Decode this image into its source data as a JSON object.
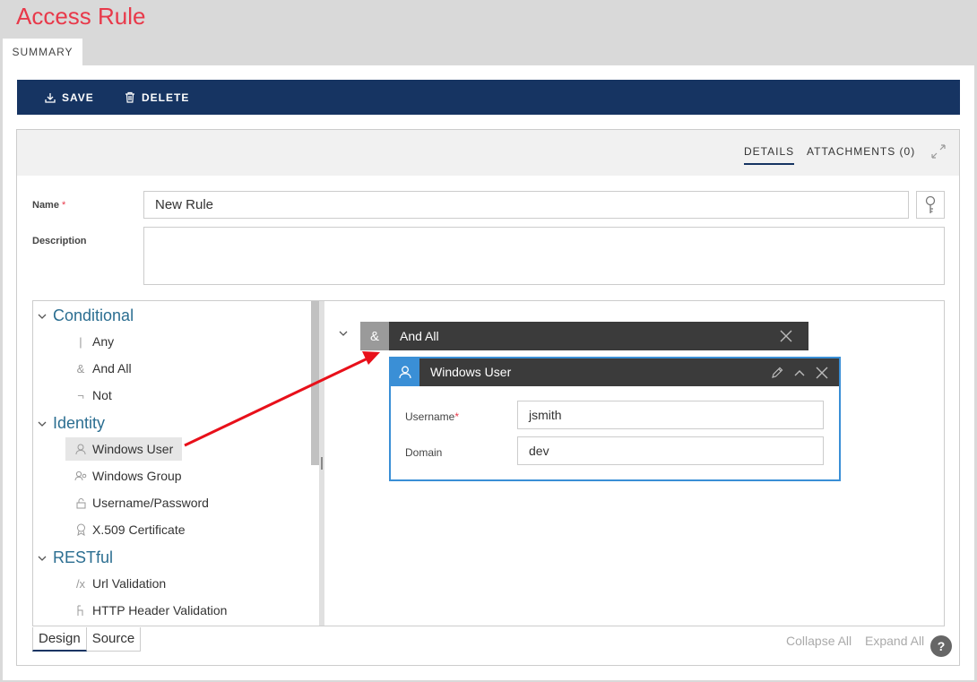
{
  "page": {
    "title": "Access Rule"
  },
  "tabs": [
    {
      "label": "SUMMARY"
    }
  ],
  "toolbar": {
    "save_label": "SAVE",
    "delete_label": "DELETE"
  },
  "panel": {
    "tabs": {
      "details": "DETAILS",
      "attachments": "ATTACHMENTS (0)"
    }
  },
  "form": {
    "name_label": "Name",
    "required_mark": "*",
    "name_value": "New Rule",
    "description_label": "Description",
    "description_value": ""
  },
  "palette": {
    "groups": [
      {
        "title": "Conditional",
        "items": [
          {
            "label": "Any",
            "icon": "|"
          },
          {
            "label": "And All",
            "icon": "&"
          },
          {
            "label": "Not",
            "icon": "¬"
          }
        ]
      },
      {
        "title": "Identity",
        "items": [
          {
            "label": "Windows User",
            "icon": "user-icon"
          },
          {
            "label": "Windows Group",
            "icon": "user-group-icon"
          },
          {
            "label": "Username/Password",
            "icon": "lock-icon"
          },
          {
            "label": "X.509 Certificate",
            "icon": "certificate-icon"
          }
        ]
      },
      {
        "title": "RESTful",
        "items": [
          {
            "label": "Url Validation",
            "icon": "/x"
          },
          {
            "label": "HTTP Header Validation",
            "icon": "header-icon"
          }
        ]
      }
    ]
  },
  "canvas": {
    "and_node": {
      "icon": "&",
      "title": "And All"
    },
    "user_node": {
      "title": "Windows User",
      "username_label": "Username",
      "username_value": "jsmith",
      "domain_label": "Domain",
      "domain_value": "dev"
    }
  },
  "bottom": {
    "design_tab": "Design",
    "source_tab": "Source",
    "collapse_all": "Collapse All",
    "expand_all": "Expand All",
    "help": "?"
  },
  "colors": {
    "title_red": "#e8394a",
    "navy": "#163462",
    "accent_blue": "#3a8fd6",
    "annotation_arrow": "#e8101a"
  }
}
